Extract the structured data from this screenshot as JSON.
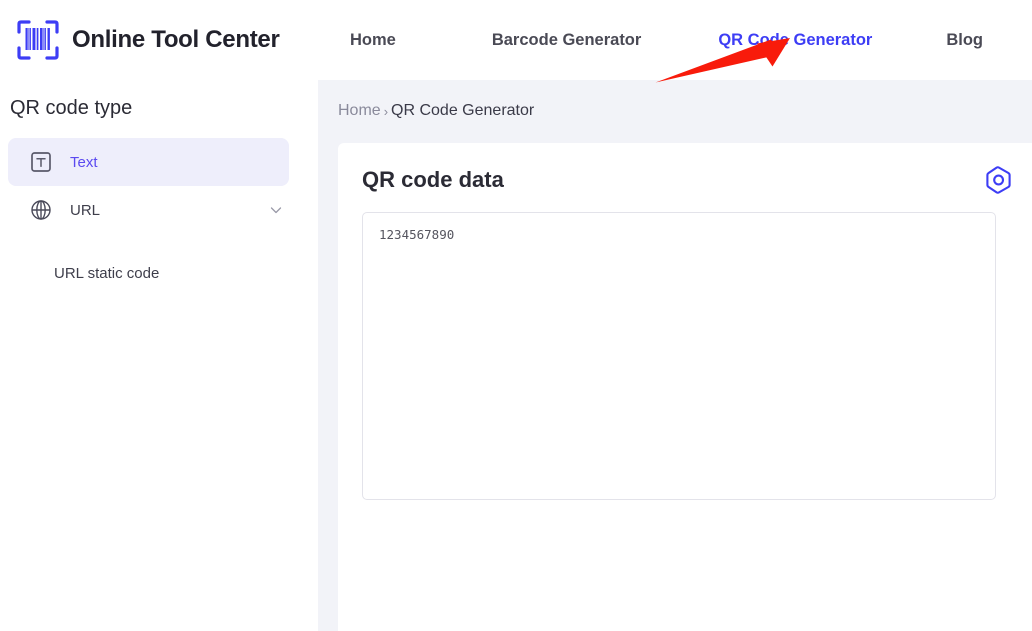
{
  "brand": {
    "name": "Online Tool Center",
    "logo_icon": "barcode-scanner-icon"
  },
  "nav": {
    "items": [
      {
        "label": "Home",
        "active": false
      },
      {
        "label": "Barcode Generator",
        "active": false
      },
      {
        "label": "QR Code Generator",
        "active": true
      },
      {
        "label": "Blog",
        "active": false
      }
    ],
    "active_color": "#3d3df5",
    "inactive_color": "#4a4a55"
  },
  "sidebar": {
    "title": "QR code type",
    "items": [
      {
        "label": "Text",
        "icon": "text-box-icon",
        "active": true
      },
      {
        "label": "URL",
        "icon": "globe-icon",
        "active": false,
        "expand_icon": "chevron-down-icon"
      }
    ],
    "sub_items": [
      {
        "label": "URL static code"
      }
    ],
    "active_bg": "#eeeefb",
    "active_text_color": "#5b4af0"
  },
  "breadcrumb": {
    "home": "Home",
    "separator": "›",
    "current": "QR Code Generator"
  },
  "card": {
    "title": "QR code data",
    "settings_icon": "hexagon-settings-icon",
    "textarea": {
      "value": "1234567890",
      "placeholder": ""
    }
  },
  "annotation": {
    "arrow_color": "#f81b0b",
    "points_to": "QR Code Generator"
  }
}
